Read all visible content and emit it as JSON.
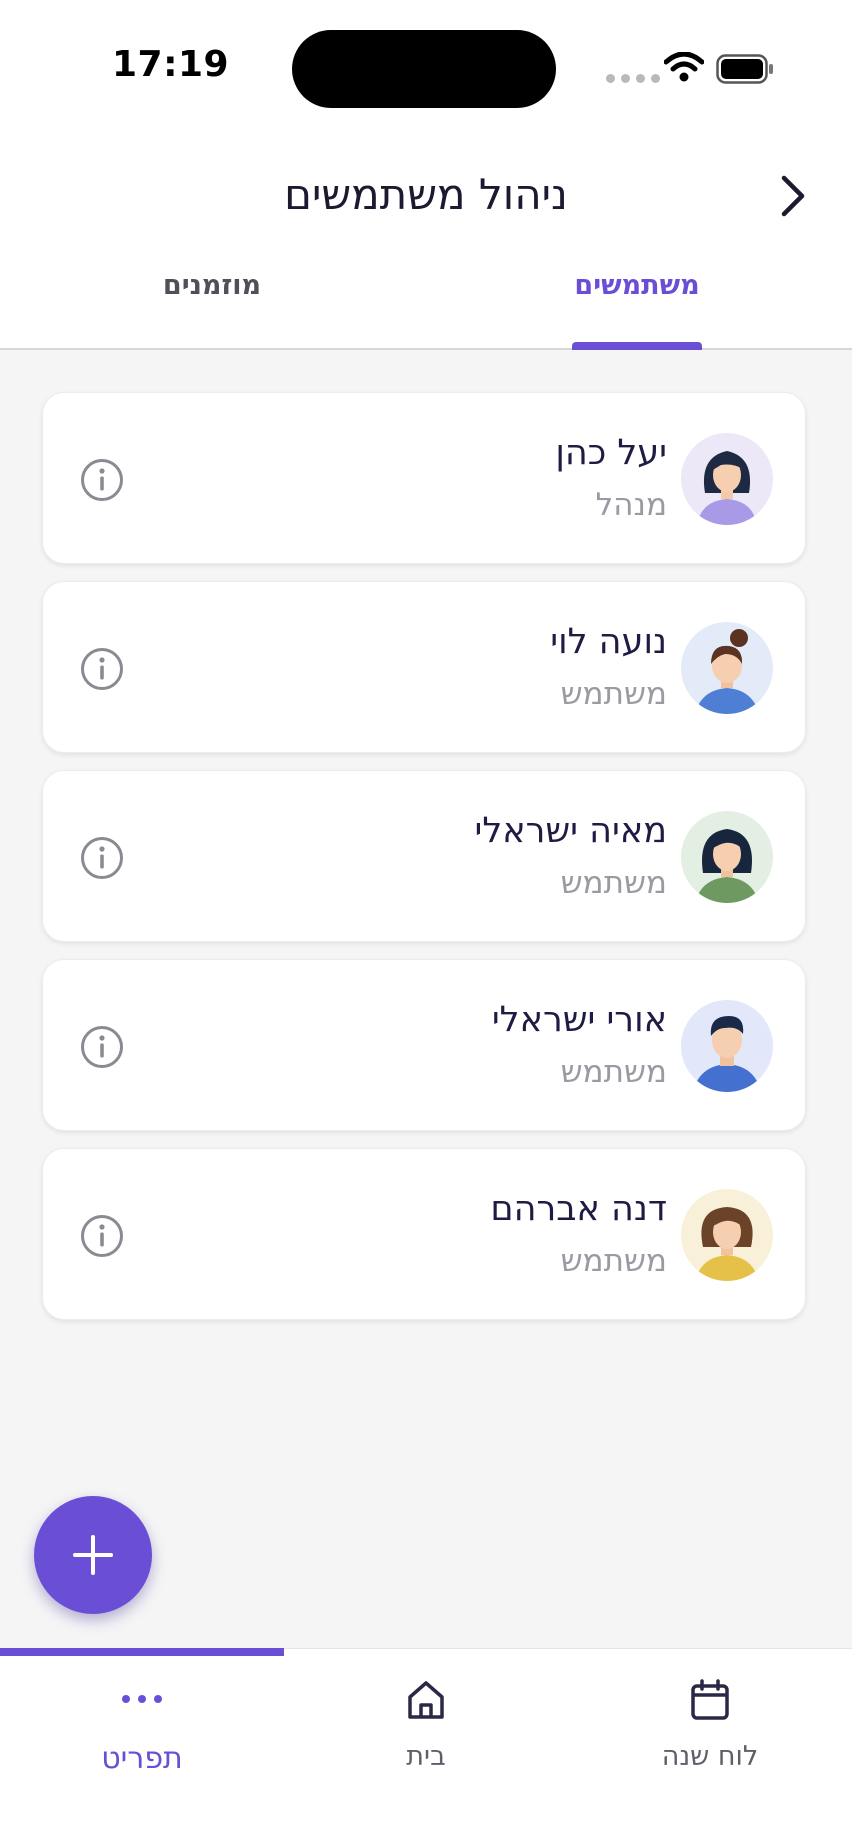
{
  "status_bar": {
    "time": "17:19"
  },
  "header": {
    "title": "ניהול משתמשים",
    "tabs": [
      {
        "label": "משתמשים",
        "active": true
      },
      {
        "label": "מוזמנים",
        "active": false
      }
    ]
  },
  "users": [
    {
      "name": "יעל כהן",
      "role": "מנהל",
      "avatar_icon": "woman-avatar-icon",
      "avatar_bg": "#ece8f7"
    },
    {
      "name": "נועה לוי",
      "role": "משתמש",
      "avatar_icon": "woman-bun-avatar-icon",
      "avatar_bg": "#e3ebf9"
    },
    {
      "name": "מאיה ישראלי",
      "role": "משתמש",
      "avatar_icon": "woman-avatar-icon",
      "avatar_bg": "#e2efe2"
    },
    {
      "name": "אורי ישראלי",
      "role": "משתמש",
      "avatar_icon": "man-avatar-icon",
      "avatar_bg": "#e2e8f9"
    },
    {
      "name": "דנה אברהם",
      "role": "משתמש",
      "avatar_icon": "woman-avatar-icon",
      "avatar_bg": "#f8f0d8"
    }
  ],
  "bottom_nav": [
    {
      "label": "תפריט",
      "icon": "more-dots-icon",
      "active": true
    },
    {
      "label": "בית",
      "icon": "home-icon",
      "active": false
    },
    {
      "label": "לוח שנה",
      "icon": "calendar-icon",
      "active": false
    }
  ],
  "colors": {
    "accent": "#6a4fd6",
    "background": "#f5f5f6",
    "card": "#ffffff"
  }
}
